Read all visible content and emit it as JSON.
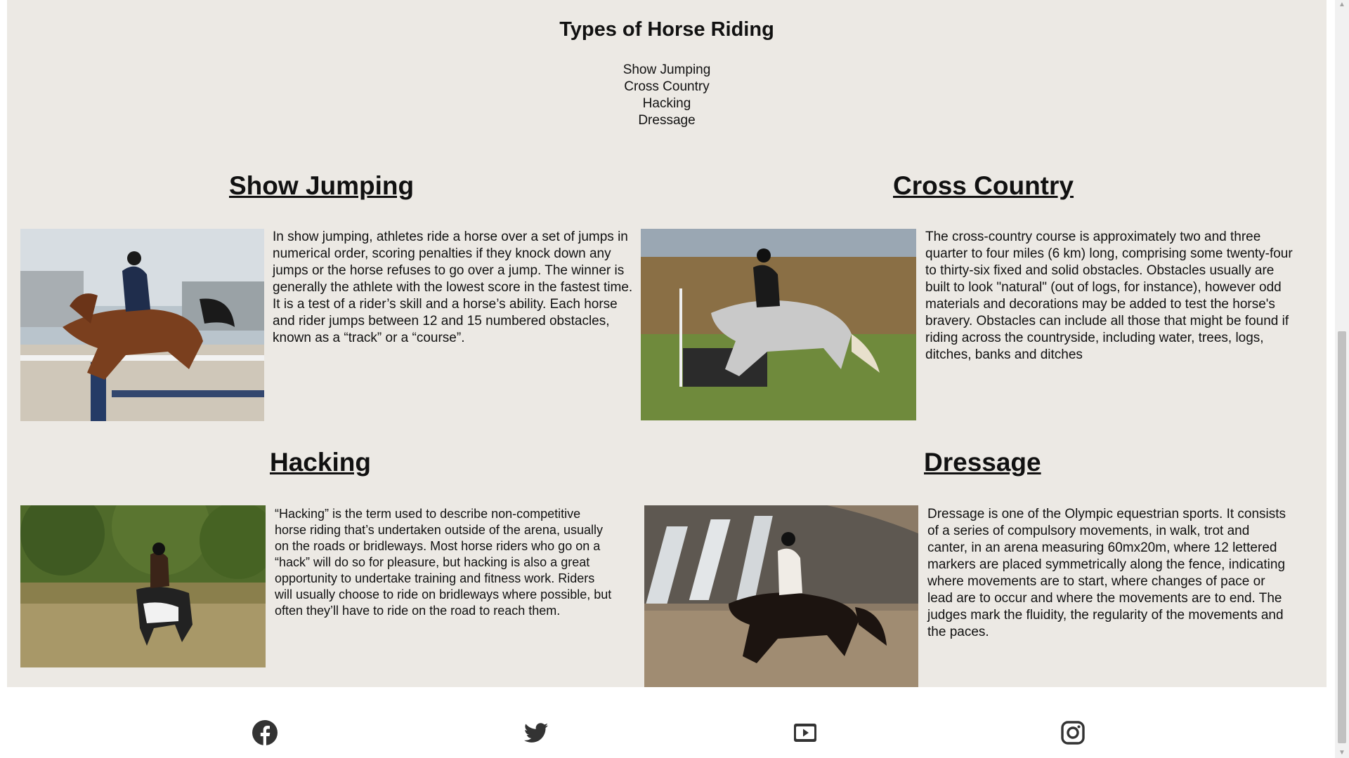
{
  "page": {
    "title": "Types of Horse Riding",
    "toc": [
      "Show Jumping",
      "Cross Country",
      "Hacking",
      "Dressage"
    ]
  },
  "sections": [
    {
      "title": "Show Jumping",
      "text": "In show jumping, athletes ride a horse over a set of jumps in numerical order, scoring penalties if they knock down any jumps or the horse refuses to go over a jump. The winner is generally the athlete with the lowest score in the fastest time. It is a test of a rider’s skill and a horse’s ability. Each horse and rider jumps between 12 and 15 numbered obstacles, known as a “track” or a “course”.",
      "image": "rider-jumping-horse-photo"
    },
    {
      "title": "Cross Country",
      "text": "The cross-country course is approximately two and three quarter to four miles (6 km) long, comprising some twenty-four to thirty-six fixed and solid obstacles. Obstacles usually are built to look \"natural\" (out of logs, for instance), however odd materials and decorations may be added to test the horse's bravery. Obstacles can include all those that might be found if riding across the countryside, including water, trees, logs, ditches, banks and ditches",
      "image": "grey-horse-cross-country-photo"
    },
    {
      "title": "Hacking",
      "text": "“Hacking” is the term used to describe non-competitive horse riding that’s undertaken outside of the arena, usually on the roads or bridleways. Most horse riders who go on a “hack” will do so for pleasure, but hacking is also a great opportunity to undertake training and fitness work. Riders will usually choose to ride on bridleways where possible, but often they’ll have to ride on the road to reach them.",
      "image": "piebald-horse-field-photo"
    },
    {
      "title": "Dressage",
      "text": "Dressage is one of the Olympic equestrian sports. It consists of a series of compulsory movements, in walk, trot and canter, in an arena measuring 60mx20m, where 12 lettered markers are placed symmetrically along the fence, indicating where movements are to start, where changes of pace or lead are to occur and where the movements are to end. The judges mark the fluidity, the regularity of the movements and the paces.",
      "image": "black-horse-indoor-arena-photo"
    }
  ],
  "footer": {
    "icons": [
      "facebook-icon",
      "twitter-icon",
      "youtube-icon",
      "instagram-icon"
    ]
  },
  "colors": {
    "page_background": "#ece9e4",
    "text": "#111111"
  }
}
